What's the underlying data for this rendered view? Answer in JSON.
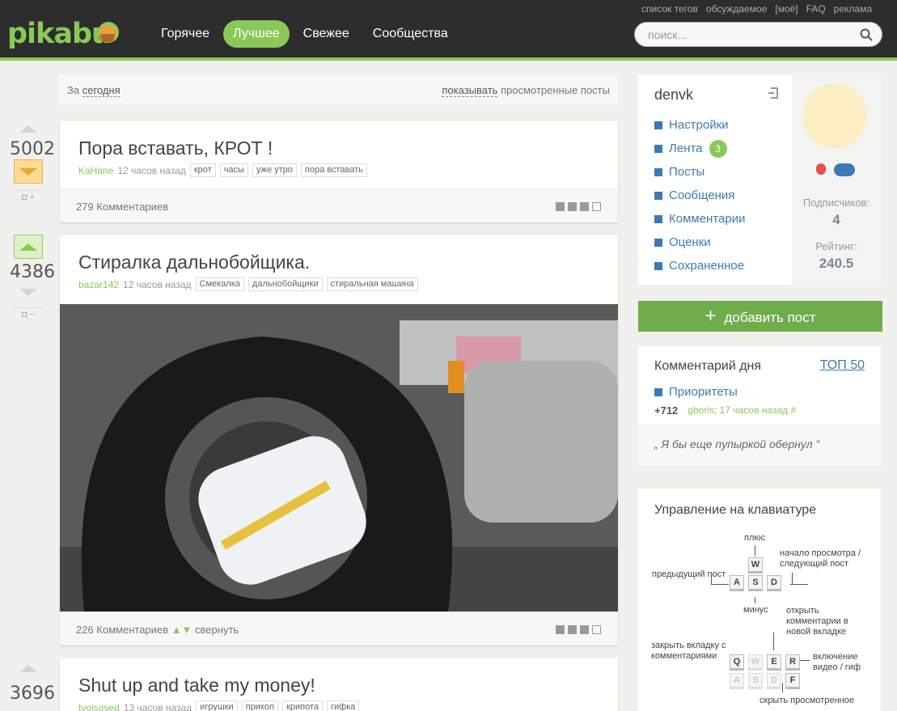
{
  "header": {
    "logo": "pikabu",
    "nav": [
      "Горячее",
      "Лучшее",
      "Свежее",
      "Сообщества"
    ],
    "active_nav": "Лучшее",
    "top_links": [
      "список тегов",
      "обсуждаемое",
      "[моё]",
      "FAQ",
      "реклама"
    ],
    "search_placeholder": "поиск..."
  },
  "filter": {
    "prefix": "За",
    "period": "сегодня",
    "show": "показывать",
    "suffix": "просмотренные посты"
  },
  "posts": [
    {
      "rating": "5002",
      "title": "Пора вставать, КРОТ !",
      "author": "KaHane",
      "time": "12 часов назад",
      "tags": [
        "крот",
        "часы",
        "уже утро",
        "пора вставать"
      ],
      "comments": "279 Комментариев",
      "vote_small": "+"
    },
    {
      "rating": "4386",
      "title": "Стиралка дальнобойщика.",
      "author": "bazar142",
      "time": "12 часов назад",
      "tags": [
        "Смекалка",
        "дальнобойщики",
        "стиральная машина"
      ],
      "comments": "226 Комментариев",
      "collapse": "свернуть",
      "vote_small": "−"
    },
    {
      "rating": "3696",
      "title": "Shut up and take my money!",
      "author": "tvoisosed",
      "time": "13 часов назад",
      "tags": [
        "игрушки",
        "прикол",
        "крипота",
        "гифка"
      ]
    }
  ],
  "user": {
    "name": "denvk",
    "menu": [
      {
        "icon": "gear-icon",
        "label": "Настройки"
      },
      {
        "icon": "feed-icon",
        "label": "Лента",
        "badge": "3"
      },
      {
        "icon": "posts-icon",
        "label": "Посты"
      },
      {
        "icon": "mail-icon",
        "label": "Сообщения"
      },
      {
        "icon": "comment-icon",
        "label": "Комментарии"
      },
      {
        "icon": "rating-icon",
        "label": "Оценки"
      },
      {
        "icon": "save-icon",
        "label": "Сохраненное"
      }
    ],
    "subs_label": "Подписчиков:",
    "subs": "4",
    "rating_label": "Рейтинг:",
    "rating": "240.5"
  },
  "add_post": "добавить пост",
  "comment_of_day": {
    "title": "Комментарий дня",
    "top": "ТОП 50",
    "post": "Приоритеты",
    "score": "+712",
    "author": "gboris;",
    "time": "17 часов назад",
    "hash": "#",
    "quote": "„ Я бы еще пупыркой обернул ”"
  },
  "keyboard": {
    "title": "Управление на клавиатуре",
    "labels": {
      "plus": "плюс",
      "start": "начало просмотра / следующий пост",
      "prev": "предыдущий пост",
      "minus": "минус",
      "open": "открыть комментарии в новой вкладке",
      "close": "закрыть вкладку с комментариями",
      "video": "включение видео / гиф",
      "hide": "скрыть просмотренное"
    },
    "keys1": [
      "W",
      "A",
      "S",
      "D"
    ],
    "keys2": [
      "Q",
      "W",
      "E",
      "R",
      "A",
      "S",
      "D",
      "F"
    ]
  },
  "colors": {
    "accent": "#8ac858",
    "link": "#3b7bb5",
    "header": "#2d2d2d"
  }
}
